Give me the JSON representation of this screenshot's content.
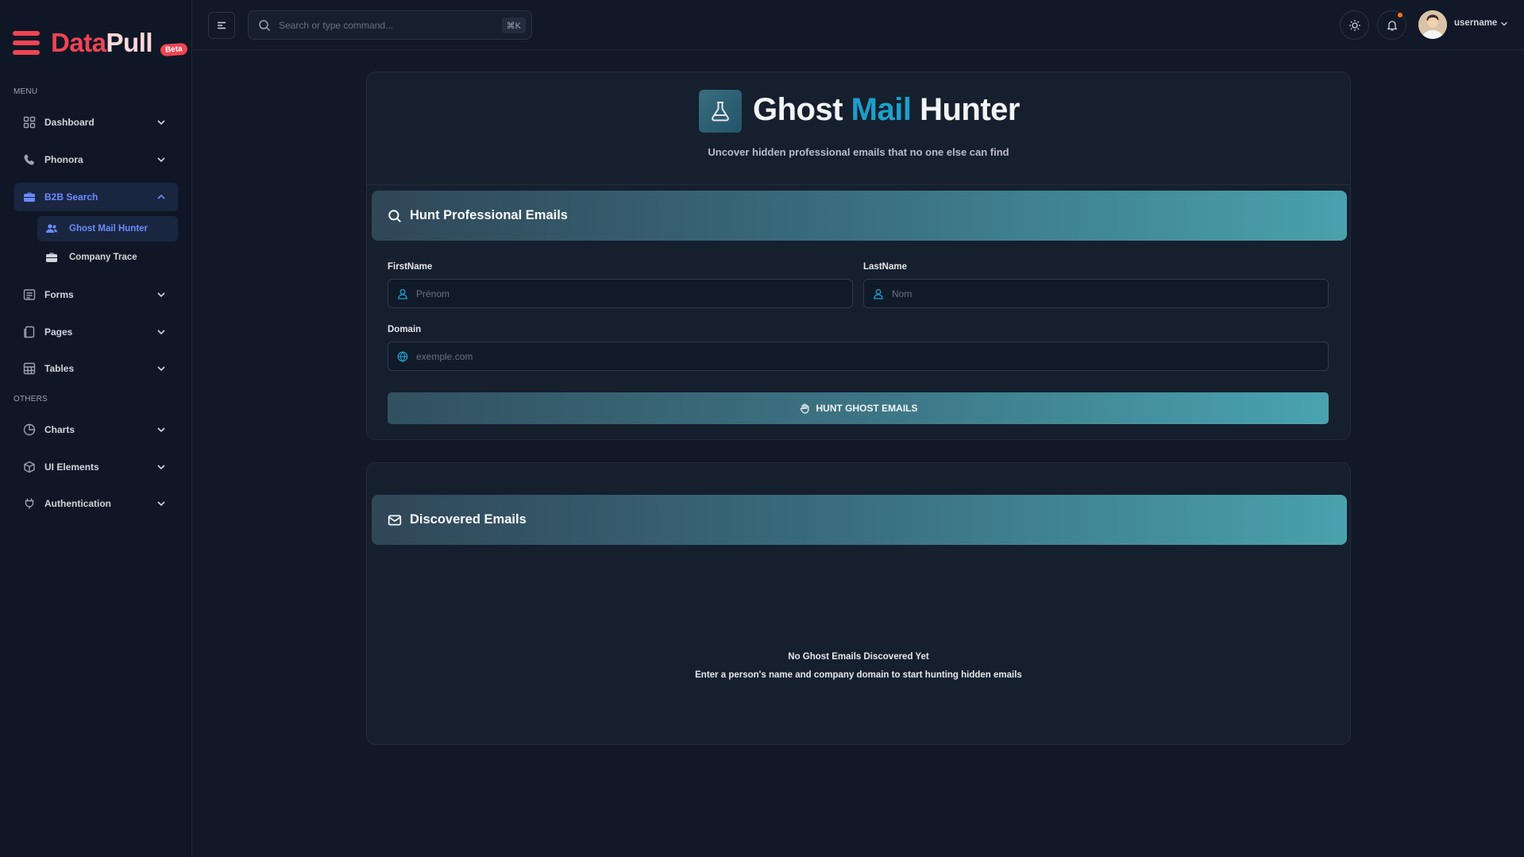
{
  "brand": {
    "part1": "Data",
    "part2": "Pull",
    "badge": "Beta"
  },
  "sidebar": {
    "menu_heading": "MENU",
    "others_heading": "OTHERS",
    "items": [
      {
        "label": "Dashboard",
        "icon": "grid-icon"
      },
      {
        "label": "Phonora",
        "icon": "phone-icon"
      },
      {
        "label": "B2B Search",
        "icon": "briefcase-icon"
      },
      {
        "label": "Forms",
        "icon": "form-icon"
      },
      {
        "label": "Pages",
        "icon": "pages-icon"
      },
      {
        "label": "Tables",
        "icon": "table-icon"
      },
      {
        "label": "Charts",
        "icon": "pie-chart-icon"
      },
      {
        "label": "UI Elements",
        "icon": "box-icon"
      },
      {
        "label": "Authentication",
        "icon": "plug-icon"
      }
    ],
    "subitems": [
      {
        "label": "Ghost Mail Hunter",
        "icon": "users-icon"
      },
      {
        "label": "Company Trace",
        "icon": "briefcase-icon"
      }
    ]
  },
  "header": {
    "search_placeholder": "Search or type command...",
    "shortcut": "⌘K",
    "username": "username"
  },
  "hero": {
    "title_part1": "Ghost ",
    "title_accent": "Mail",
    "title_part2": " Hunter",
    "subtitle": "Uncover hidden professional emails that no one else can find"
  },
  "form": {
    "section_title": "Hunt Professional Emails",
    "firstname_label": "FirstName",
    "firstname_placeholder": "Prénom",
    "firstname_value": "",
    "lastname_label": "LastName",
    "lastname_placeholder": "Nom",
    "lastname_value": "",
    "domain_label": "Domain",
    "domain_placeholder": "exemple.com",
    "domain_value": "",
    "submit_label": "HUNT GHOST EMAILS"
  },
  "results": {
    "section_title": "Discovered Emails",
    "empty_title": "No Ghost Emails Discovered Yet",
    "empty_subtitle": "Enter a person's name and company domain to start hunting hidden emails"
  },
  "colors": {
    "brand_red": "#ef4454",
    "accent_blue": "#1d9fc9",
    "active_nav": "#6b8cff",
    "background": "#111827",
    "card": "#161f2e"
  }
}
